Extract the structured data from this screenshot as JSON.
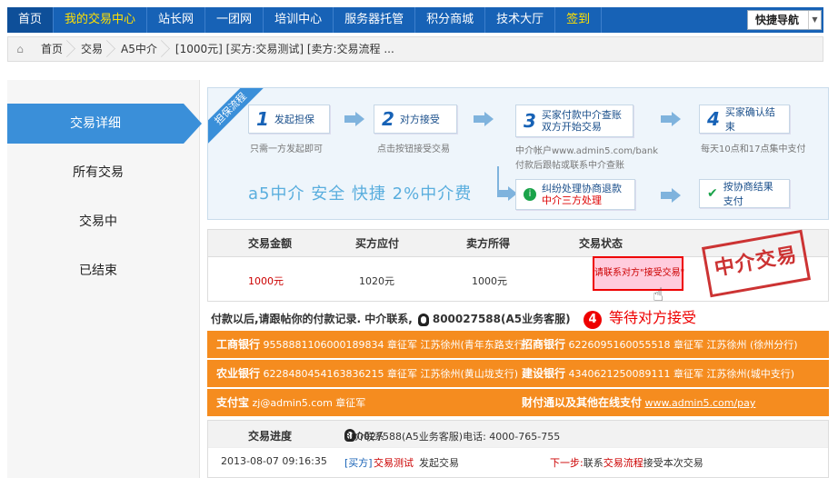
{
  "nav": {
    "items": [
      "首页",
      "我的交易中心",
      "站长网",
      "一团网",
      "培训中心",
      "服务器托管",
      "积分商城",
      "技术大厅",
      "签到"
    ],
    "quick": "快捷导航"
  },
  "breadcrumb": [
    "首页",
    "交易",
    "A5中介",
    "[1000元] [买方:交易测试] [卖方:交易流程 ..."
  ],
  "sidebar": {
    "items": [
      "交易详细",
      "所有交易",
      "交易中",
      "已结束"
    ]
  },
  "flow": {
    "ribbon": "担保流程",
    "steps": [
      {
        "num": "1",
        "label": "发起担保",
        "desc": "只需一方发起即可"
      },
      {
        "num": "2",
        "label": "对方接受",
        "desc": "点击按钮接受交易"
      },
      {
        "num": "3",
        "label_line1": "买家付款中介查账",
        "label_line2": "双方开始交易",
        "desc1": "中介帐户www.admin5.com/bank",
        "desc2": "付款后跟帖或联系中介查账"
      },
      {
        "num": "4",
        "label": "买家确认结束",
        "desc": "每天10点和17点集中支付"
      }
    ],
    "dispute_line1": "纠纷处理协商退款",
    "dispute_line2": "中介三方处理",
    "settle": "按协商结果支付",
    "slogan": "a5中介  安全 快捷  2%中介费"
  },
  "table": {
    "headers": [
      "交易金额",
      "买方应付",
      "卖方所得",
      "交易状态"
    ],
    "row": {
      "amount": "1000元",
      "buyer": "1020元",
      "seller": "1000元",
      "status": "请联系对方\"接受交易\""
    }
  },
  "stamp": "中介交易",
  "notice": {
    "text": "付款以后,请跟帖你的付款记录. 中介联系,",
    "phone": "800027588(A5业务客服)"
  },
  "wait": {
    "num": "4",
    "text": "等待对方接受"
  },
  "banks": [
    {
      "n1": "工商银行",
      "v1": "9558881106000189834 章征军 江苏徐州(青年东路支行)",
      "n2": "招商银行",
      "v2": "6226095160055518 章征军 江苏徐州 (徐州分行)"
    },
    {
      "n1": "农业银行",
      "v1": "6228480454163836215 章征军 江苏徐州(黄山垅支行)",
      "n2": "建设银行",
      "v2": "4340621250089111 章征军 江苏徐州(城中支行)"
    },
    {
      "n1": "支付宝",
      "v1": "zj@admin5.com 章征军",
      "n2": "财付通以及其他在线支付",
      "v2": "www.admin5.com/pay"
    }
  ],
  "progress": {
    "title": "交易进度",
    "contact": "中介联系",
    "phone": "800027588(A5业务客服)电话: 4000-765-755",
    "time": "2013-08-07 09:16:35",
    "tag": "[买方]",
    "buyer": "交易测试",
    "action": "发起交易",
    "next_label": "下一步:",
    "next_pre": "联系",
    "next_link": "交易流程",
    "next_post": "接受本次交易"
  }
}
